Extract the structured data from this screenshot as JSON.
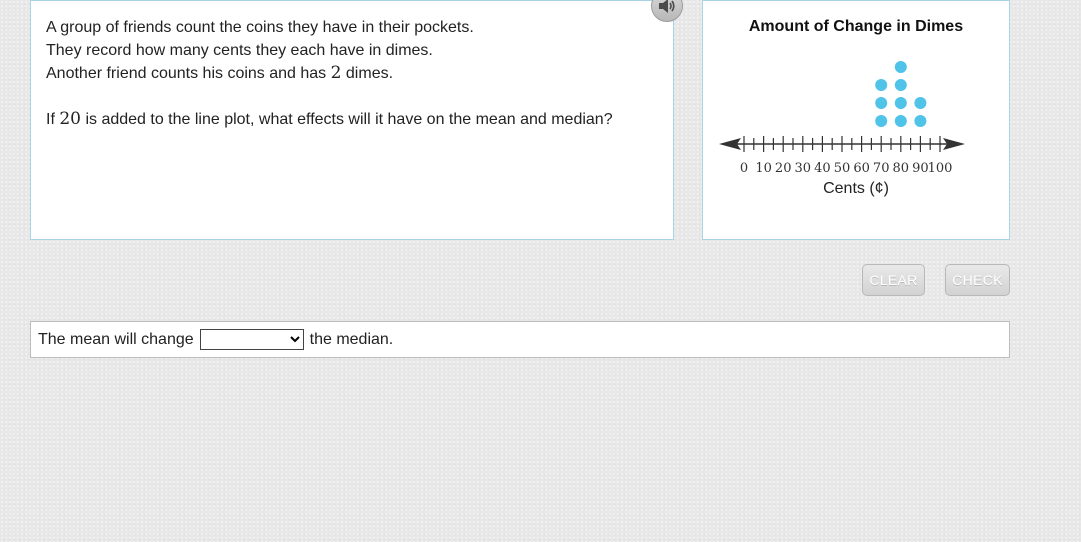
{
  "question": {
    "line1": "A group of friends count the coins they have in their pockets.",
    "line2": "They record how many cents they each have in dimes.",
    "line3_before": "Another friend counts his coins and has",
    "line3_num": "2",
    "line3_after": "dimes.",
    "prompt_before": "If",
    "prompt_num": "20",
    "prompt_after": "is added to the line plot, what effects will it have on the mean and median?"
  },
  "audio": {
    "icon": "speaker-icon"
  },
  "chart_data": {
    "type": "scatter",
    "subtype": "dot plot",
    "title": "Amount of Change in Dimes",
    "xlabel": "Cents (¢)",
    "ticks": [
      "0",
      "10",
      "20",
      "30",
      "40",
      "50",
      "60",
      "70",
      "80",
      "90",
      "100"
    ],
    "xlim": [
      0,
      100
    ],
    "points": [
      {
        "x": 70,
        "count": 3
      },
      {
        "x": 80,
        "count": 4
      },
      {
        "x": 90,
        "count": 2
      }
    ],
    "dot_color": "#4fc3e8"
  },
  "buttons": {
    "clear": "CLEAR",
    "check": "CHECK"
  },
  "answer": {
    "before": "The mean will change",
    "select_value": "",
    "after": "the median."
  }
}
